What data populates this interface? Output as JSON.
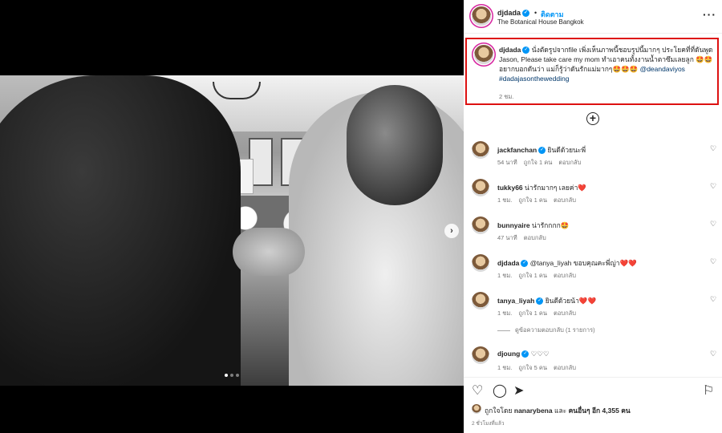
{
  "header": {
    "username": "djdada",
    "separator": "•",
    "follow_label": "ติดตาม",
    "location": "The Botanical House Bangkok",
    "more_icon": "more-horizontal-icon"
  },
  "caption": {
    "username": "djdada",
    "text": "นั่งตัดรูปจากfile เพิ่งเห็นภาพนี้ชอบรูปนี้มากๆ ประโยคที่ที่ดันพูด Jason, Please take care my mom ทำเอาคนทั้งงานน้ำตาซึมเลยลูก 🤩🤩 อยากบอกดันว่า แม่ก็รู้ว่าดันรักแม่มากๆ🤩🤩🤩",
    "mention": "@deandaviyos",
    "hashtag": "#dadajasonthewedding",
    "time": "2 ชม."
  },
  "comments": [
    {
      "username": "jackfanchan",
      "text": "ยินดีด้วยนะพี่",
      "time": "54 นาที",
      "likes": "ถูกใจ 1 คน",
      "reply": "ตอบกลับ"
    },
    {
      "username": "tukky66",
      "text": "น่ารักมากๆ เลยค่า❤️",
      "time": "1 ชม.",
      "likes": "ถูกใจ 1 คน",
      "reply": "ตอบกลับ"
    },
    {
      "username": "bunnyaire",
      "text": "น่ารักกกก🤩",
      "time": "47 นาที",
      "likes": "",
      "reply": "ตอบกลับ"
    },
    {
      "username": "djdada",
      "text": "@tanya_liyah ขอบคุณคะพี่ญ่า❤️❤️",
      "time": "1 ชม.",
      "likes": "ถูกใจ 1 คน",
      "reply": "ตอบกลับ"
    },
    {
      "username": "tanya_liyah",
      "text": "ยินดีด้วยน้า❤️❤️",
      "time": "1 ชม.",
      "likes": "ถูกใจ 1 คน",
      "reply": "ตอบกลับ"
    },
    {
      "username": "djoung",
      "text": "♡♡♡",
      "time": "1 ชม.",
      "likes": "ถูกใจ 5 คน",
      "reply": "ตอบกลับ"
    }
  ],
  "view_replies": "ดูข้อความตอบกลับ (1 รายการ)",
  "footer": {
    "liked_by": "ถูกใจโดย",
    "liked_user": "nanarybena",
    "and_others_prefix": "และ",
    "and_others": "คนอื่นๆ อีก 4,355 คน",
    "time": "2 ชั่วโมงที่แล้ว"
  },
  "colors": {
    "accent": "#0095f6",
    "highlight_border": "#dd1111",
    "heart_red": "#e0152b"
  }
}
